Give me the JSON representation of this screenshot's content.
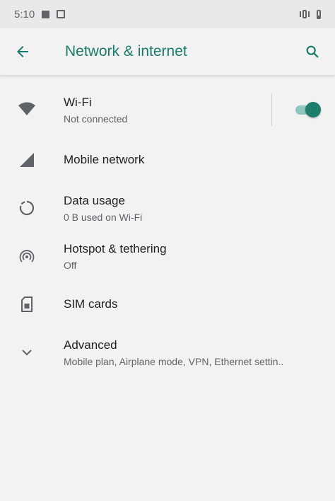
{
  "statusbar": {
    "time": "5:10"
  },
  "toolbar": {
    "title": "Network & internet"
  },
  "items": [
    {
      "title": "Wi-Fi",
      "summary": "Not connected",
      "toggle_on": true
    },
    {
      "title": "Mobile network"
    },
    {
      "title": "Data usage",
      "summary": "0 B used on Wi-Fi"
    },
    {
      "title": "Hotspot & tethering",
      "summary": "Off"
    },
    {
      "title": "SIM cards"
    },
    {
      "title": "Advanced",
      "summary": "Mobile plan, Airplane mode, VPN, Ethernet settin.."
    }
  ],
  "colors": {
    "accent": "#1a7a6b",
    "toggle_thumb": "#1f7d6e",
    "toggle_track": "#8fc7be",
    "background": "#f2f2f2"
  },
  "icons": [
    "back-arrow-icon",
    "search-icon",
    "wifi-icon",
    "signal-icon",
    "data-usage-icon",
    "hotspot-icon",
    "sim-card-icon",
    "chevron-down-icon"
  ]
}
